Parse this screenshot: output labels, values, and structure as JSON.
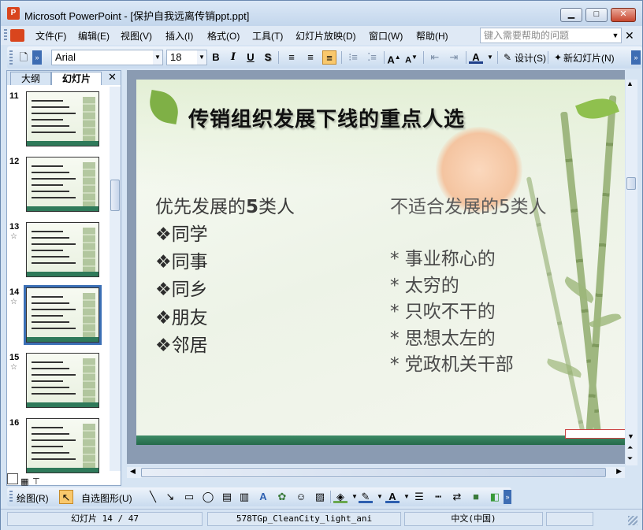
{
  "window": {
    "title": "Microsoft PowerPoint - [保护自我远离传销ppt.ppt]",
    "app_icon_label": "P"
  },
  "menu": {
    "items": [
      "文件(F)",
      "编辑(E)",
      "视图(V)",
      "插入(I)",
      "格式(O)",
      "工具(T)",
      "幻灯片放映(D)",
      "窗口(W)",
      "帮助(H)"
    ],
    "help_placeholder": "键入需要帮助的问题"
  },
  "format_toolbar": {
    "font_name": "Arial",
    "font_size": "18",
    "design_label": "设计(S)",
    "new_slide_label": "新幻灯片(N)"
  },
  "left_panel": {
    "tabs": [
      "大纲",
      "幻灯片"
    ],
    "selected_tab": "幻灯片",
    "thumbnails": [
      {
        "number": "11",
        "star": false,
        "selected": false
      },
      {
        "number": "12",
        "star": false,
        "selected": false
      },
      {
        "number": "13",
        "star": true,
        "selected": false
      },
      {
        "number": "14",
        "star": true,
        "selected": true
      },
      {
        "number": "15",
        "star": true,
        "selected": false
      },
      {
        "number": "16",
        "star": false,
        "selected": false
      }
    ]
  },
  "slide": {
    "title": "传销组织发展下线的重点人选",
    "left_heading_pre": "优先发展的",
    "left_heading_num": "5",
    "left_heading_post": "类人",
    "left_items": [
      "❖同学",
      "❖同事",
      "❖同乡",
      "❖朋友",
      "❖邻居"
    ],
    "right_heading": "不适合发展的5类人",
    "right_items": [
      "* 事业称心的",
      "* 太穷的",
      "* 只吹不干的",
      "* 思想太左的",
      "* 党政机关干部"
    ]
  },
  "draw_toolbar": {
    "draw_label": "绘图(R)",
    "autoshape_label": "自选图形(U)"
  },
  "status_bar": {
    "slide_position": "幻灯片 14 / 47",
    "template": "578TGp_CleanCity_light_ani",
    "language": "中文(中国)"
  },
  "colors": {
    "accent_selected": "#3b6fb5",
    "slide_bar": "#2f7a5a",
    "close_button": "#c8472f"
  }
}
